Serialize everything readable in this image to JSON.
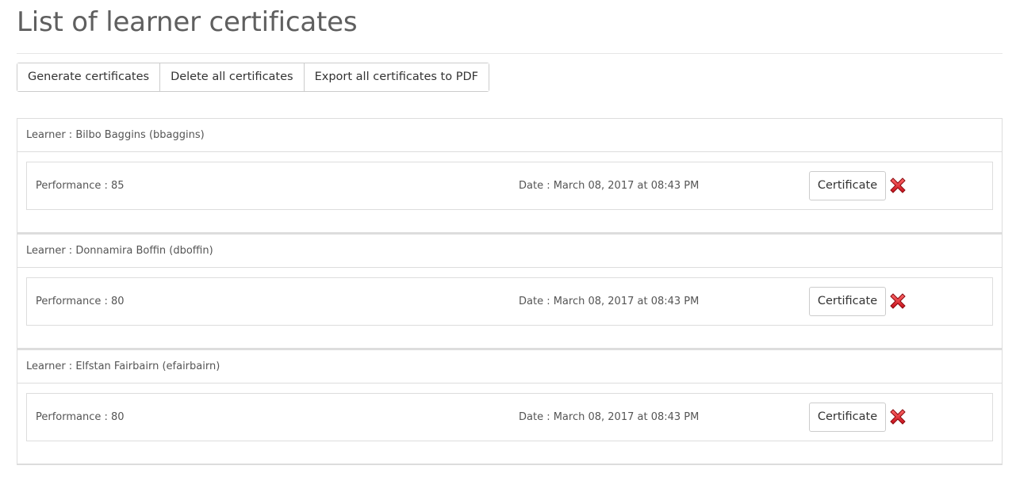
{
  "page": {
    "title": "List of learner certificates"
  },
  "toolbar": {
    "generate_label": "Generate certificates",
    "delete_all_label": "Delete all certificates",
    "export_label": "Export all certificates to PDF"
  },
  "learners": [
    {
      "header": "Learner : Bilbo Baggins (bbaggins)",
      "performance": "Performance : 85",
      "date": "Date : March 08, 2017 at 08:43 PM",
      "certificate_label": "Certificate",
      "delete_icon": "red-x-delete-icon"
    },
    {
      "header": "Learner : Donnamira Boffin (dboffin)",
      "performance": "Performance : 80",
      "date": "Date : March 08, 2017 at 08:43 PM",
      "certificate_label": "Certificate",
      "delete_icon": "red-x-delete-icon"
    },
    {
      "header": "Learner : Elfstan Fairbairn (efairbairn)",
      "performance": "Performance : 80",
      "date": "Date : March 08, 2017 at 08:43 PM",
      "certificate_label": "Certificate",
      "delete_icon": "red-x-delete-icon"
    }
  ],
  "colors": {
    "delete_red": "#d9262b",
    "border": "#dddddd",
    "text": "#555555"
  }
}
